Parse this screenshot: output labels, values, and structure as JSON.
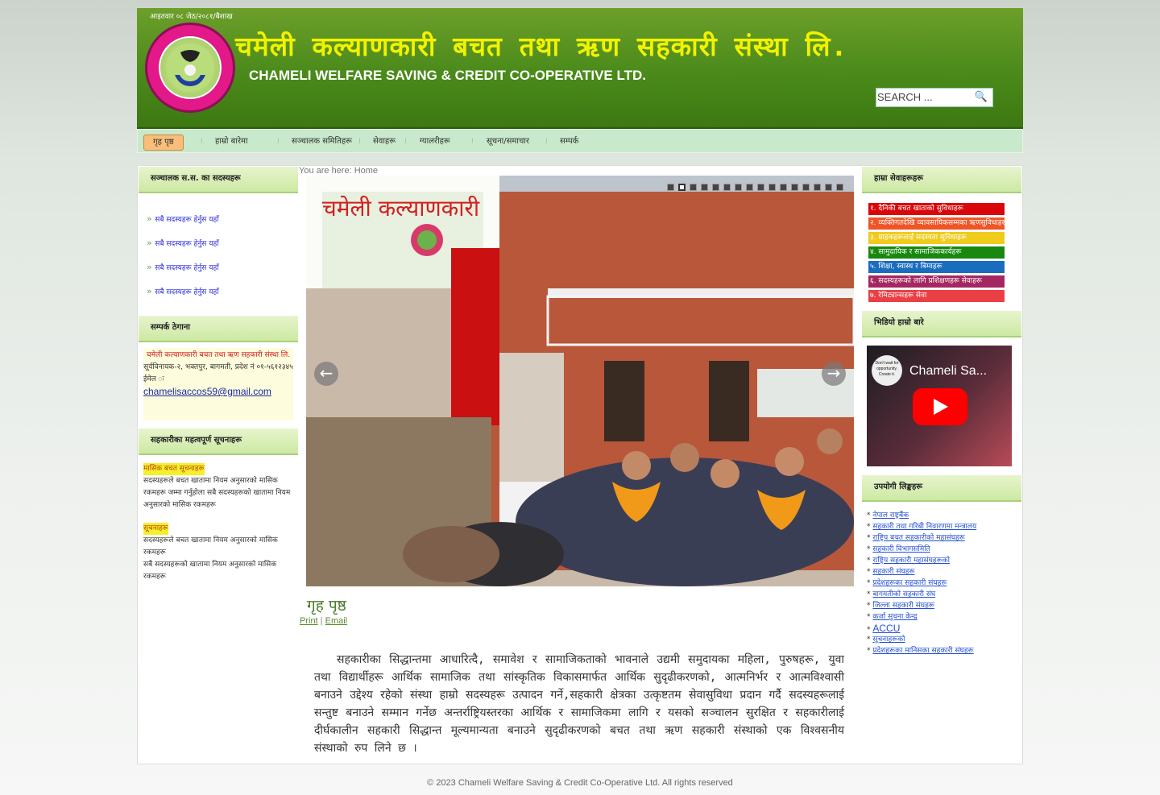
{
  "header": {
    "date": "आइतवार ०८ जेठ/२०८१/बैशाख",
    "title_np": "चमेली कल्याणकारी बचत तथा ऋण सहकारी संस्था लि.",
    "title_en": "CHAMELI WELFARE SAVING & CREDIT CO-OPERATIVE LTD.",
    "search_placeholder": "SEARCH ..."
  },
  "nav": {
    "items": [
      "गृह पृष्ठ",
      "हाम्रो बारेमा",
      "सञ्चालक समितिहरू",
      "सेवाहरू",
      "ग्यालरीहरू",
      "सूचना/समाचार",
      "सम्पर्क"
    ]
  },
  "breadcrumb": "You are here: Home",
  "left": {
    "members_title": "सञ्चालक स.स. का सदस्यहरू",
    "members_links": [
      "सबै सदस्यहरू हेर्नुस यहाँ",
      "सबै सदस्यहरू हेर्नुस यहाँ",
      "सबै सदस्यहरू हेर्नुस यहाँ",
      "सबै सदस्यहरू हेर्नुस यहाँ"
    ],
    "contact_title": "सम्पर्क ठेगाना",
    "contact_org": "चमेली कल्याणकारी बचत तथा ऋण सहकारी संस्था लि.",
    "contact_addr": "सूर्यविनायक-२, भक्तपुर, बागमती, प्रदेश नं ०१-५६१२३४५",
    "email_label": "ईमेल ः",
    "email": "chamelisaccos59@gmail.com",
    "news_title": "सहकारीका महत्वपूर्ण सूचनाहरू",
    "news1_head": "मासिक बचत सूचनाहरू",
    "news1_body": "सदस्यहरूले बचत खातामा नियम अनुसारको मासिक रकमहरू जम्मा गर्नुहोला सबै सदस्यहरूको खातामा नियम अनुसारको मासिक रकमहरू",
    "news2_head": "सूचनाहरू",
    "news2_body1": "सदस्यहरूले बचत खातामा नियम अनुसारको मासिक रकमहरू",
    "news2_body2": "सबै सदस्यहरूको खातामा नियम अनुसारको मासिक रकमहरू"
  },
  "center": {
    "slide_count": 16,
    "active_slide": 1,
    "heading": "गृह पृष्ठ",
    "print": "Print",
    "email": "Email",
    "body": "सहकारीका सिद्धान्तमा आधारित्दै, समावेश र सामाजिकताको भावनाले उद्यमी समुदायका महिला, पुरुषहरू, युवा तथा विद्यार्थीहरू आर्थिक सामाजिक तथा सांस्कृतिक विकासमार्फत आर्थिक सुदृढीकरणको, आत्मनिर्भर र आत्मविश्वासी बनाउने उद्देश्य रहेको संस्था हाम्रो सदस्यहरू उत्पादन गर्ने,सहकारी क्षेत्रका उत्कृष्टतम सेवासुविधा प्रदान गर्दै सदस्यहरूलाई सन्तुष्ट बनाउने सम्मान गर्नेछ अन्तर्राष्ट्रियस्तरका आर्थिक र सामाजिकमा लागि र यसको सञ्चालन सुरक्षित र सहकारीलाई दीर्घकालीन सहकारी सिद्धान्त मूल्यमान्यता बनाउने सुदृढीकरणको बचत तथा ऋण सहकारी संस्थाको एक विश्वसनीय संस्थाको रुप लिने छ ।"
  },
  "right": {
    "services_title": "हाम्रा सेवाहरूहरू",
    "services": [
      {
        "label": "१. दैनिकी बचत खाताको सुविधाहरू",
        "color": "#d9070a"
      },
      {
        "label": "२. व्यक्तिगतदेखि व्यावसायिकसम्मका ऋणसुविधाहरू",
        "color": "#ef5527"
      },
      {
        "label": "३. ग्राहकहरूलाई सदस्यता सुविधाहरू",
        "color": "#efcb1c"
      },
      {
        "label": "४. सामुदायिक र सामाजिककार्यहरू",
        "color": "#18880f"
      },
      {
        "label": "५. शिक्षा, स्वास्थ र बिमाहरू",
        "color": "#1a6cbe"
      },
      {
        "label": "६. सदस्यहरूको लागि प्रशिक्षणहरू सेवाहरू",
        "color": "#a42762"
      },
      {
        "label": "७. रेमिट्यान्सहरू सेवा",
        "color": "#ea3f45"
      }
    ],
    "video_title": "भिडियो हाम्रो बारे",
    "video_caption": "Chameli Sa...",
    "video_thumb_text": "Don't wait for opportunity. Create it.",
    "links_title": "उपयोगी लिङ्कहरू",
    "links": [
      "नेपाल राष्ट्रबैंक",
      "सहकारी तथा गरिबी निवारणमा मन्त्रालय",
      "राष्ट्रिय बचत सहकारीको महासंघहरू",
      "सहकारी विभागसमिति",
      "राष्ट्रिय सहकारी महासंघहरूको",
      "सहकारी संघहरू",
      "प्रदेशहरूका सहकारी संघहरू",
      "बागमतीको सहकारी संघ",
      "जिल्ला सहकारी संघहरू",
      "कर्जा सूचना केन्द्र",
      "ACCU",
      "सूचनाहरूको",
      "प्रदेशहरूका मानिसका सहकारी संघहरू"
    ]
  },
  "footer": "© 2023 Chameli Welfare Saving & Credit Co-Operative Ltd. All rights reserved"
}
